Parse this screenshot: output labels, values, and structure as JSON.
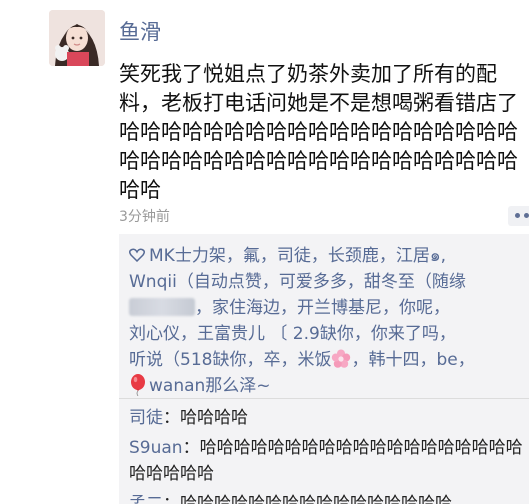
{
  "post": {
    "author": "鱼滑",
    "text": "笑死我了悦姐点了奶茶外卖加了所有的配料，老板打电话问她是不是想喝粥看错店了哈哈哈哈哈哈哈哈哈哈哈哈哈哈哈哈哈哈哈哈哈哈哈哈哈哈哈哈哈哈哈哈哈哈哈哈哈哈哈哈",
    "time": "3分钟前"
  },
  "likes": {
    "names_1": "MK士力架，氟，司徒，长颈鹿，江居",
    "names_1_sym": "๑,",
    "names_2": "Wnqii（自动点赞，可爱多多，甜冬至（随缘",
    "names_3": "，家住海边，开兰博基尼，你呢，",
    "names_4": "刘心仪，王富贵儿 〔 2.9缺你，你来了吗，",
    "names_5": "听说（518缺你，卒，米饭",
    "names_5b": "，韩十四，be，",
    "names_6": "wanan那么泽~"
  },
  "comments": [
    {
      "author": "司徒",
      "sep": "：",
      "text": "哈哈哈哈"
    },
    {
      "author": "S9uan",
      "sep": "：",
      "text": "哈哈哈哈哈哈哈哈哈哈哈哈哈哈哈哈哈哈哈哈哈哈哈哈"
    },
    {
      "author": "孟二",
      "sep": "：",
      "text": "哈哈哈哈哈哈哈哈哈哈哈哈哈哈哈哈"
    }
  ],
  "colors": {
    "link_blue": "#576b95",
    "comment_bg": "#f3f3f5"
  }
}
